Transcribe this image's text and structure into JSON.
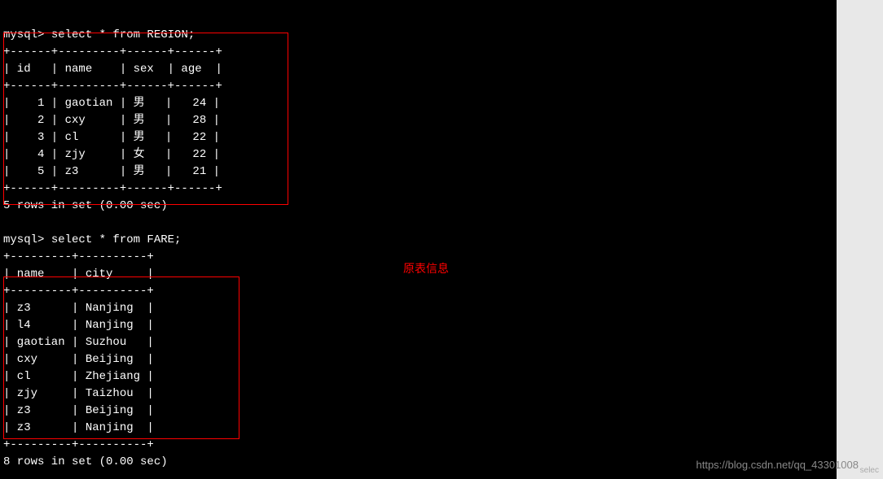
{
  "terminal": {
    "prompt1": "mysql> ",
    "query1": "select * from REGION;",
    "region_table": {
      "border_top": "+------+---------+------+------+",
      "header": "| id   | name    | sex  | age  |",
      "border_mid": "+------+---------+------+------+",
      "rows": [
        "|    1 | gaotian | 男   |   24 |",
        "|    2 | cxy     | 男   |   28 |",
        "|    3 | cl      | 男   |   22 |",
        "|    4 | zjy     | 女   |   22 |",
        "|    5 | z3      | 男   |   21 |"
      ],
      "border_bot": "+------+---------+------+------+",
      "result": "5 rows in set (0.00 sec)"
    },
    "prompt2": "mysql> ",
    "query2": "select * from FARE;",
    "fare_table": {
      "border_top": "+---------+----------+",
      "header": "| name    | city     |",
      "border_mid": "+---------+----------+",
      "rows": [
        "| z3      | Nanjing  |",
        "| l4      | Nanjing  |",
        "| gaotian | Suzhou   |",
        "| cxy     | Beijing  |",
        "| cl      | Zhejiang |",
        "| zjy     | Taizhou  |",
        "| z3      | Beijing  |",
        "| z3      | Nanjing  |"
      ],
      "border_bot": "+---------+----------+",
      "result": "8 rows in set (0.00 sec)"
    }
  },
  "annotation": "原表信息",
  "watermark": "https://blog.csdn.net/qq_43301008",
  "small_label": "selec",
  "chart_data": {
    "type": "table",
    "tables": [
      {
        "name": "REGION",
        "columns": [
          "id",
          "name",
          "sex",
          "age"
        ],
        "rows": [
          [
            1,
            "gaotian",
            "男",
            24
          ],
          [
            2,
            "cxy",
            "男",
            28
          ],
          [
            3,
            "cl",
            "男",
            22
          ],
          [
            4,
            "zjy",
            "女",
            22
          ],
          [
            5,
            "z3",
            "男",
            21
          ]
        ],
        "row_count": 5,
        "time_sec": 0.0
      },
      {
        "name": "FARE",
        "columns": [
          "name",
          "city"
        ],
        "rows": [
          [
            "z3",
            "Nanjing"
          ],
          [
            "l4",
            "Nanjing"
          ],
          [
            "gaotian",
            "Suzhou"
          ],
          [
            "cxy",
            "Beijing"
          ],
          [
            "cl",
            "Zhejiang"
          ],
          [
            "zjy",
            "Taizhou"
          ],
          [
            "z3",
            "Beijing"
          ],
          [
            "z3",
            "Nanjing"
          ]
        ],
        "row_count": 8,
        "time_sec": 0.0
      }
    ]
  }
}
